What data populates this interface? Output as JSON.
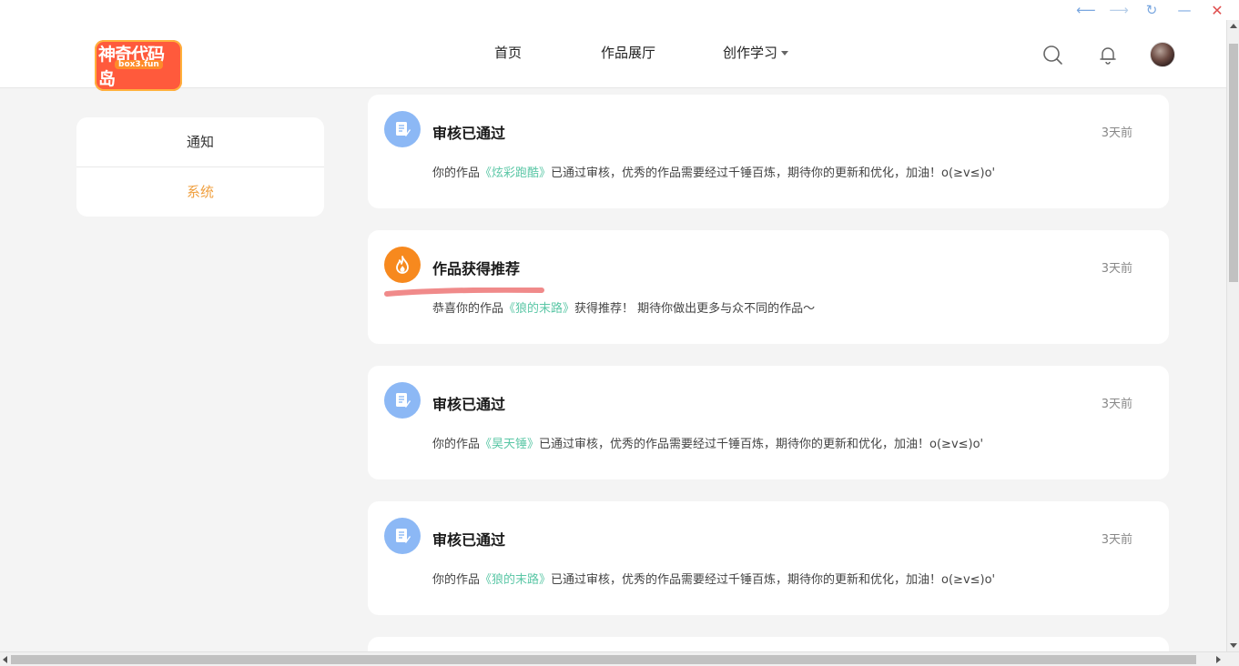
{
  "window": {
    "back_glyph": "⟵",
    "forward_glyph": "⟶",
    "refresh_glyph": "↻",
    "minimize_glyph": "—",
    "close_glyph": "✕"
  },
  "header": {
    "logo_cn": "神奇代码岛",
    "logo_en": "box3.fun",
    "nav": [
      {
        "label": "首页"
      },
      {
        "label": "作品展厅"
      },
      {
        "label": "创作学习"
      }
    ],
    "icons": [
      "search-icon",
      "bell-icon",
      "avatar"
    ]
  },
  "sidebar": {
    "items": [
      {
        "label": "通知",
        "active": false
      },
      {
        "label": "系统",
        "active": true
      }
    ],
    "active_color": "#f0a040"
  },
  "notifications": [
    {
      "icon": "document-edit-icon",
      "icon_color": "#8cb8f5",
      "title": "审核已通过",
      "time": "3天前",
      "msg_prefix": "你的作品",
      "work": "《炫彩跑酷》",
      "msg_suffix": "已通过审核，优秀的作品需要经过千锤百炼，期待你的更新和优化，加油！o(≥v≤)o'"
    },
    {
      "icon": "fire-icon",
      "icon_color": "#f7891e",
      "title": "作品获得推荐",
      "time": "3天前",
      "msg_prefix": "恭喜你的作品",
      "work": "《狼的末路》",
      "msg_suffix": "获得推荐！ 期待你做出更多与众不同的作品～"
    },
    {
      "icon": "document-edit-icon",
      "icon_color": "#8cb8f5",
      "title": "审核已通过",
      "time": "3天前",
      "msg_prefix": "你的作品",
      "work": "《昊天锤》",
      "msg_suffix": "已通过审核，优秀的作品需要经过千锤百炼，期待你的更新和优化，加油！o(≥v≤)o'"
    },
    {
      "icon": "document-edit-icon",
      "icon_color": "#8cb8f5",
      "title": "审核已通过",
      "time": "3天前",
      "msg_prefix": "你的作品",
      "work": "《狼的末路》",
      "msg_suffix": "已通过审核，优秀的作品需要经过千锤百炼，期待你的更新和优化，加油！o(≥v≤)o'"
    }
  ],
  "colors": {
    "work_link": "#5bc7a6",
    "highlight_mark": "#f08a8a"
  }
}
